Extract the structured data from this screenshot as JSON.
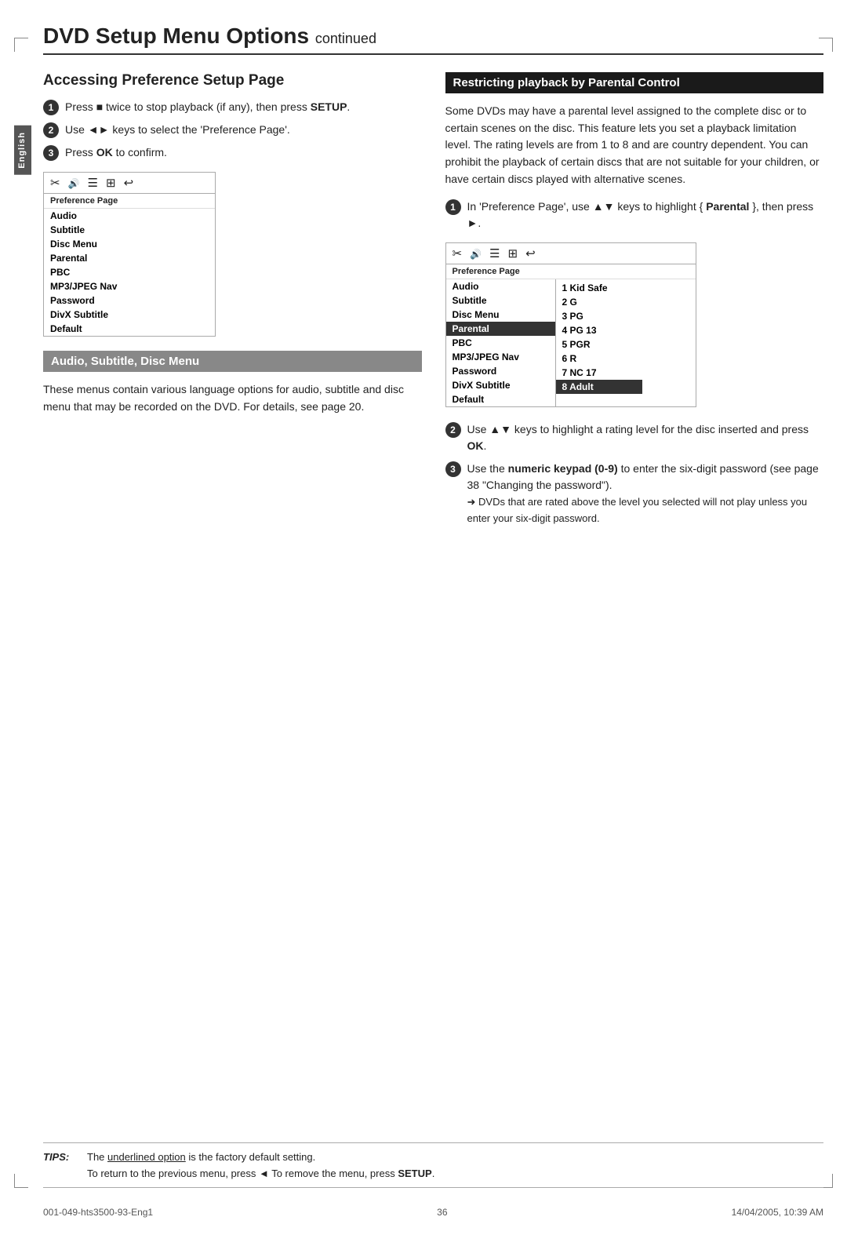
{
  "page": {
    "title": "DVD Setup Menu Options",
    "title_continued": "continued",
    "page_number": "36"
  },
  "sidebar": {
    "label": "English"
  },
  "left_column": {
    "heading": "Accessing Preference Setup Page",
    "steps": [
      {
        "num": "1",
        "text_before": "Press ",
        "symbol": "■",
        "text_after": " twice to stop playback (if any), then press ",
        "bold": "SETUP",
        "bold_after": ""
      },
      {
        "num": "2",
        "text": "Use ◄► keys to select the 'Preference Page'."
      },
      {
        "num": "3",
        "text_before": "Press ",
        "bold": "OK",
        "text_after": " to confirm."
      }
    ],
    "menu1": {
      "icons": [
        "✂",
        "🔊",
        "☰",
        "⊞",
        "↩"
      ],
      "label": "Preference Page",
      "items": [
        "Audio",
        "Subtitle",
        "Disc Menu",
        "Parental",
        "PBC",
        "MP3/JPEG Nav",
        "Password",
        "DivX Subtitle",
        "Default"
      ],
      "highlighted": ""
    },
    "subsection": {
      "heading": "Audio, Subtitle, Disc Menu",
      "body": "These menus contain various language options for audio, subtitle and disc menu that may be recorded on the DVD.  For details, see page 20."
    }
  },
  "right_column": {
    "heading": "Restricting playback by Parental Control",
    "intro": "Some DVDs may have a parental level assigned to the complete disc or to certain scenes on the disc. This feature lets you set a playback limitation level. The rating levels are from 1 to 8 and are country dependent. You can prohibit the playback of certain discs that are not suitable for your children, or have certain discs played with alternative scenes.",
    "steps": [
      {
        "num": "1",
        "text_before": "In 'Preference Page', use ▲▼ keys to highlight { ",
        "bold": "Parental",
        "text_after": " }, then press ►."
      },
      {
        "num": "2",
        "text_before": "Use ▲▼ keys to highlight a rating level for the disc inserted and press ",
        "bold": "OK",
        "text_after": "."
      },
      {
        "num": "3",
        "text_before": "Use the ",
        "bold": "numeric keypad (0-9)",
        "text_after": " to enter the six-digit password (see page 38 \"Changing the password\")."
      }
    ],
    "arrow_tip": "➜ DVDs that are rated above the level you selected will not play unless you enter your six-digit password.",
    "menu2": {
      "icons": [
        "✂",
        "🔊",
        "☰",
        "⊞",
        "↩"
      ],
      "label": "Preference Page",
      "items": [
        "Audio",
        "Subtitle",
        "Disc Menu",
        "Parental",
        "PBC",
        "MP3/JPEG Nav",
        "Password",
        "DivX Subtitle",
        "Default"
      ],
      "highlighted": "Parental",
      "subitems": [
        "1  Kid Safe",
        "2  G",
        "3  PG",
        "4  PG 13",
        "5  PGR",
        "6  R",
        "7  NC 17",
        "8  Adult"
      ],
      "sub_highlighted": "8  Adult"
    }
  },
  "tips": {
    "label": "TIPS:",
    "line1_prefix": "The ",
    "line1_underline": "underlined option",
    "line1_suffix": " is the factory default setting.",
    "line2_before": "To return to the previous menu, press ◄  To remove the menu, press ",
    "line2_bold": "SETUP",
    "line2_after": "."
  },
  "footer": {
    "left": "001-049-hts3500-93-Eng1",
    "center": "36",
    "right": "14/04/2005, 10:39 AM"
  }
}
